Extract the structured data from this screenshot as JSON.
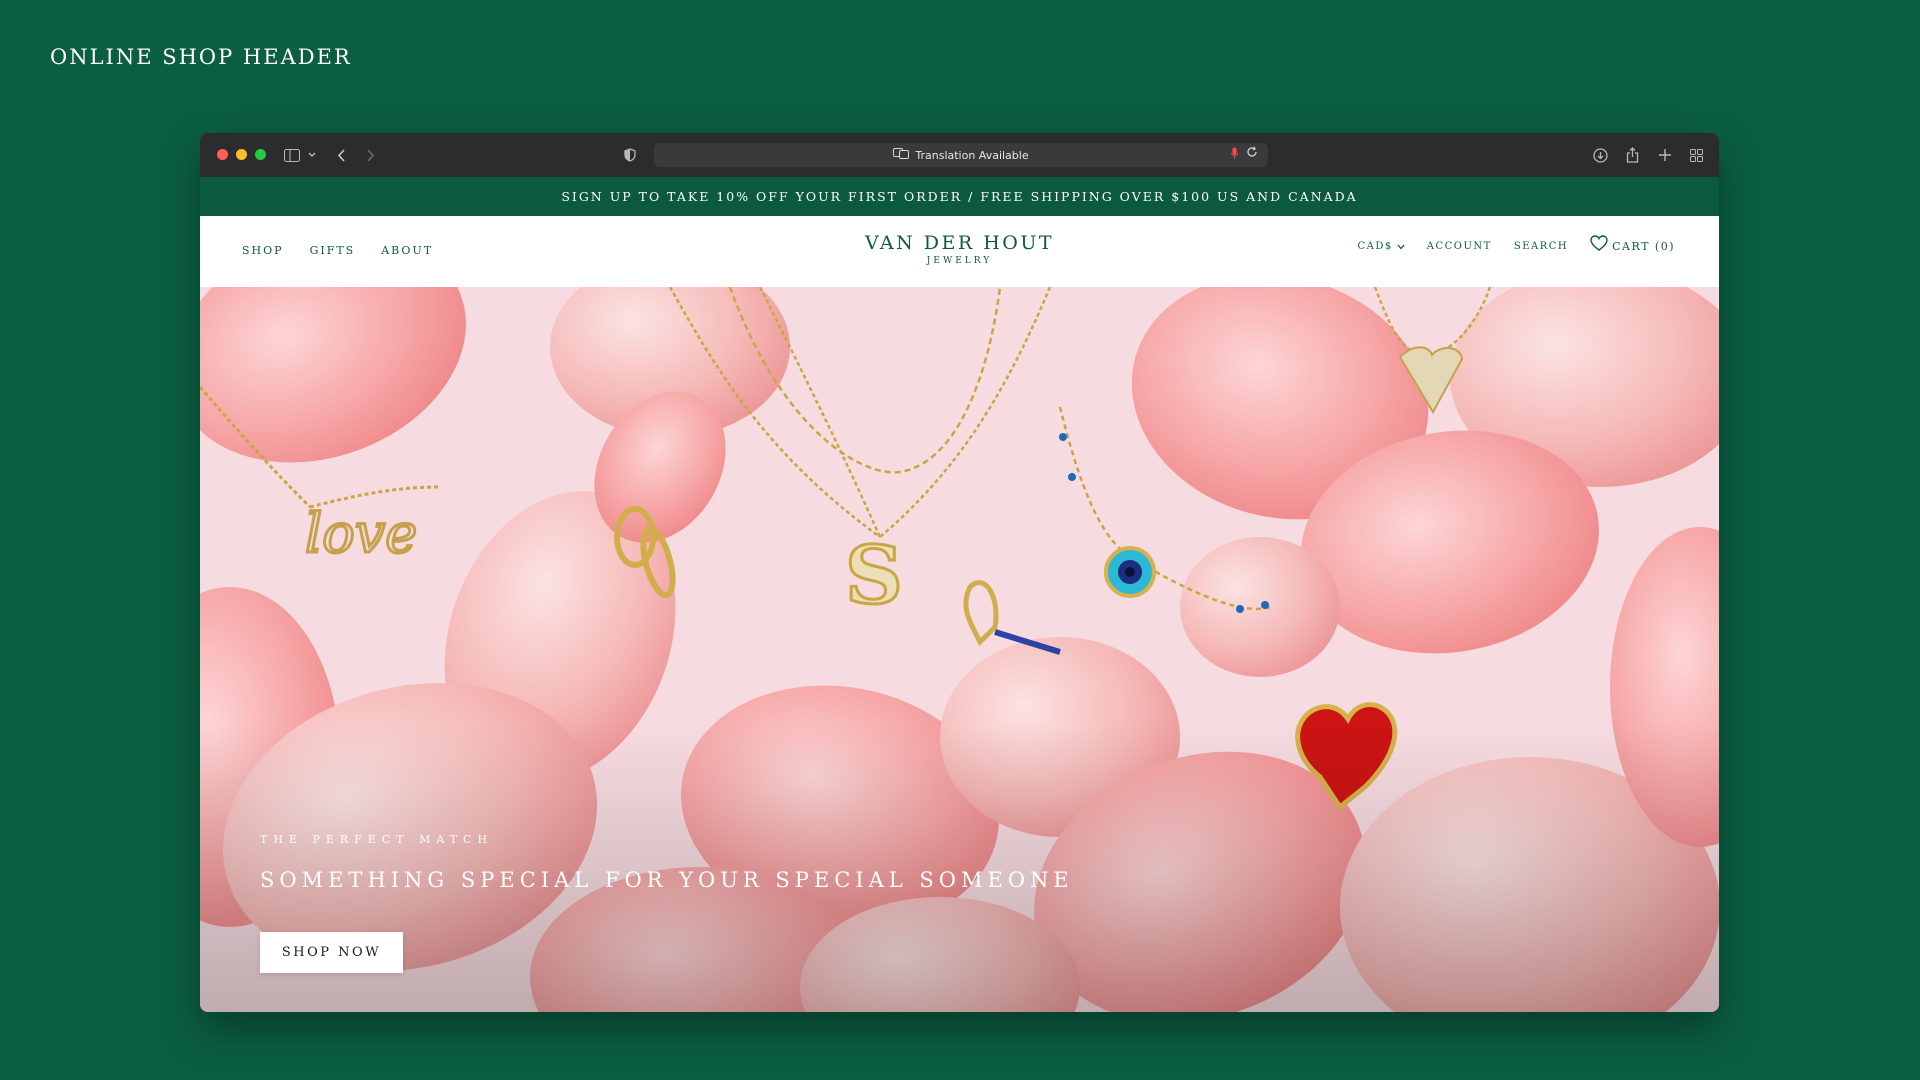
{
  "page_label": "ONLINE SHOP HEADER",
  "browser": {
    "address_text": "Translation Available",
    "icons": [
      "sidebar-icon",
      "chevron-down-icon",
      "back-icon",
      "forward-icon",
      "shield-icon",
      "translate-icon",
      "microphone-icon",
      "reload-icon",
      "download-icon",
      "share-icon",
      "new-tab-icon",
      "tab-overview-icon"
    ]
  },
  "promo": {
    "text": "SIGN UP TO TAKE 10% OFF YOUR FIRST ORDER / FREE SHIPPING OVER $100 US AND CANADA"
  },
  "header": {
    "nav_left": [
      "SHOP",
      "GIFTS",
      "ABOUT"
    ],
    "brand_name": "VAN DER HOUT",
    "brand_sub": "JEWELRY",
    "currency": "CAD$",
    "account": "ACCOUNT",
    "search": "SEARCH",
    "cart": "CART (0)"
  },
  "hero": {
    "eyebrow": "THE PERFECT MATCH",
    "headline": "SOMETHING SPECIAL FOR YOUR SPECIAL SOMEONE",
    "button": "SHOP NOW",
    "scene": [
      "love-necklace",
      "letter-s-necklace",
      "evil-eye-bracelet",
      "pave-heart-necklace",
      "hoop-earrings",
      "sapphire-huggie-earring",
      "red-heart-pendant",
      "rose-petals"
    ]
  },
  "colors": {
    "background": "#0b5e42",
    "promo_bar": "#0b5a3f",
    "brand_green": "#0f5a3f",
    "hero_pink": "#f7d6dc"
  }
}
